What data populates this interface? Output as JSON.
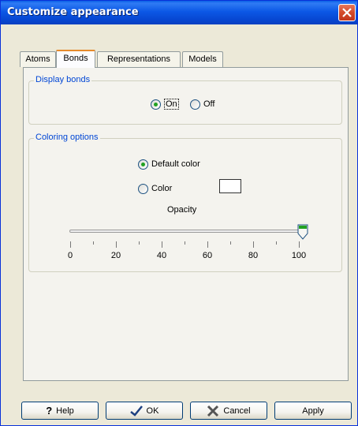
{
  "window": {
    "title": "Customize appearance"
  },
  "tabs": [
    {
      "label": "Atoms"
    },
    {
      "label": "Bonds",
      "active": true
    },
    {
      "label": "Representations"
    },
    {
      "label": "Models"
    }
  ],
  "display_bonds": {
    "title": "Display bonds",
    "on_label": "On",
    "off_label": "Off",
    "selected": "On"
  },
  "coloring": {
    "title": "Coloring options",
    "default_label": "Default color",
    "color_label": "Color",
    "selected": "Default color",
    "swatch_color": "#ffffff",
    "opacity_label": "Opacity",
    "opacity_value": 100,
    "ticks": [
      "0",
      "20",
      "40",
      "60",
      "80",
      "100"
    ]
  },
  "buttons": {
    "help": "Help",
    "ok": "OK",
    "cancel": "Cancel",
    "apply": "Apply"
  }
}
